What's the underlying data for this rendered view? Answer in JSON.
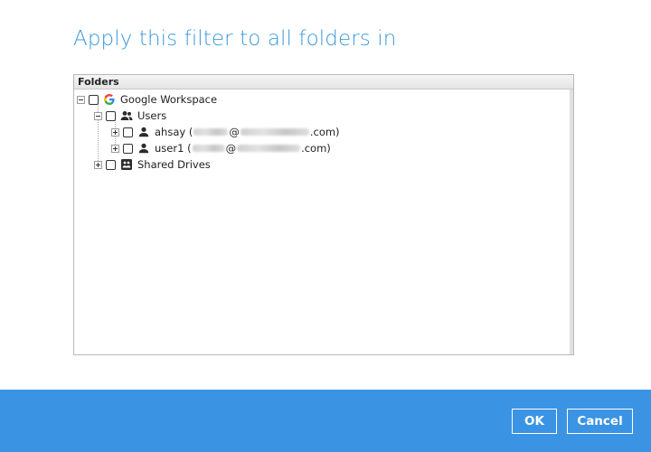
{
  "dialog": {
    "title": "Apply this filter to all folders in"
  },
  "tree": {
    "column_header": "Folders",
    "root": {
      "label": "Google Workspace",
      "icon": "google-icon"
    },
    "users": {
      "label": "Users",
      "icon": "users-icon"
    },
    "user_1": {
      "name": "ahsay",
      "open_paren": "(",
      "at_sign": "@",
      "domain_suffix": ".com)",
      "icon": "user-icon"
    },
    "user_2": {
      "name": "user1",
      "open_paren": "(",
      "at_sign": "@",
      "domain_suffix": ".com)",
      "icon": "user-icon"
    },
    "shared_drives": {
      "label": "Shared Drives",
      "icon": "shared-drive-icon"
    }
  },
  "buttons": {
    "ok_label": "OK",
    "cancel_label": "Cancel"
  },
  "colors": {
    "title": "#3a9ad9",
    "footer": "#3b94e3",
    "button_border": "#ffffff"
  }
}
